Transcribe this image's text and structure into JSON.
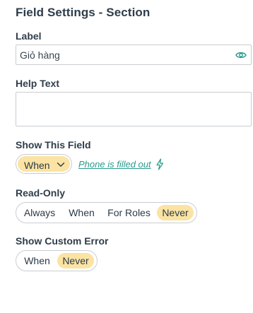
{
  "panel": {
    "title": "Field Settings - Section"
  },
  "label_field": {
    "label": "Label",
    "value": "Giỏ hàng",
    "visibility_icon": "eye-icon"
  },
  "help_text": {
    "label": "Help Text",
    "value": ""
  },
  "show_field": {
    "label": "Show This Field",
    "selected": "When",
    "condition_link": "Phone is filled out",
    "condition_icon": "lightning-icon"
  },
  "read_only": {
    "label": "Read-Only",
    "options": [
      "Always",
      "When",
      "For Roles",
      "Never"
    ],
    "selected": "Never"
  },
  "custom_error": {
    "label": "Show Custom Error",
    "options": [
      "When",
      "Never"
    ],
    "selected": "Never"
  },
  "colors": {
    "accent": "#2a9a8d",
    "selected_bg": "#fbe3a3",
    "border": "#c9cdd1",
    "text": "#2f3d4a"
  }
}
